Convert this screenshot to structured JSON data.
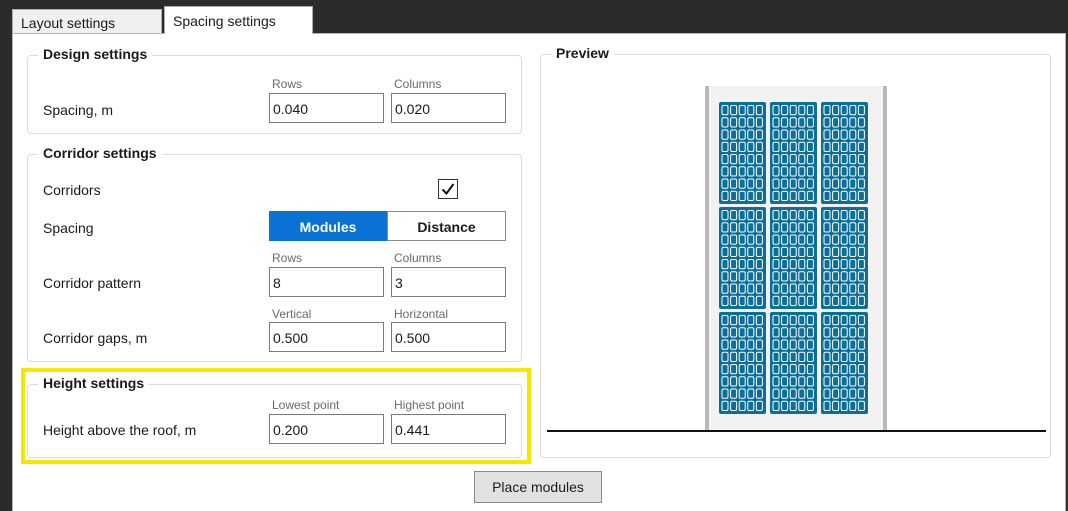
{
  "tabs": [
    {
      "label": "Layout settings",
      "active": false
    },
    {
      "label": "Spacing settings",
      "active": true
    }
  ],
  "design": {
    "title": "Design settings",
    "spacing_label": "Spacing, m",
    "rows_caption": "Rows",
    "columns_caption": "Columns",
    "rows_value": "0.040",
    "columns_value": "0.020"
  },
  "corridor": {
    "title": "Corridor settings",
    "corridors_label": "Corridors",
    "corridors_checked": true,
    "spacing_label": "Spacing",
    "spacing_options": [
      "Modules",
      "Distance"
    ],
    "spacing_selected": "Modules",
    "pattern_label": "Corridor pattern",
    "pattern_rows_caption": "Rows",
    "pattern_columns_caption": "Columns",
    "pattern_rows_value": "8",
    "pattern_columns_value": "3",
    "gaps_label": "Corridor gaps, m",
    "gaps_vertical_caption": "Vertical",
    "gaps_horizontal_caption": "Horizontal",
    "gaps_vertical_value": "0.500",
    "gaps_horizontal_value": "0.500"
  },
  "height": {
    "title": "Height settings",
    "label": "Height above the roof, m",
    "lowest_caption": "Lowest point",
    "highest_caption": "Highest point",
    "lowest_value": "0.200",
    "highest_value": "0.441",
    "highlight_color": "#f5e700"
  },
  "preview": {
    "title": "Preview",
    "module_color": "#0b6f9a",
    "block_rows": 3,
    "block_columns": 3,
    "modules_per_block": 8
  },
  "actions": {
    "place_label": "Place modules"
  }
}
